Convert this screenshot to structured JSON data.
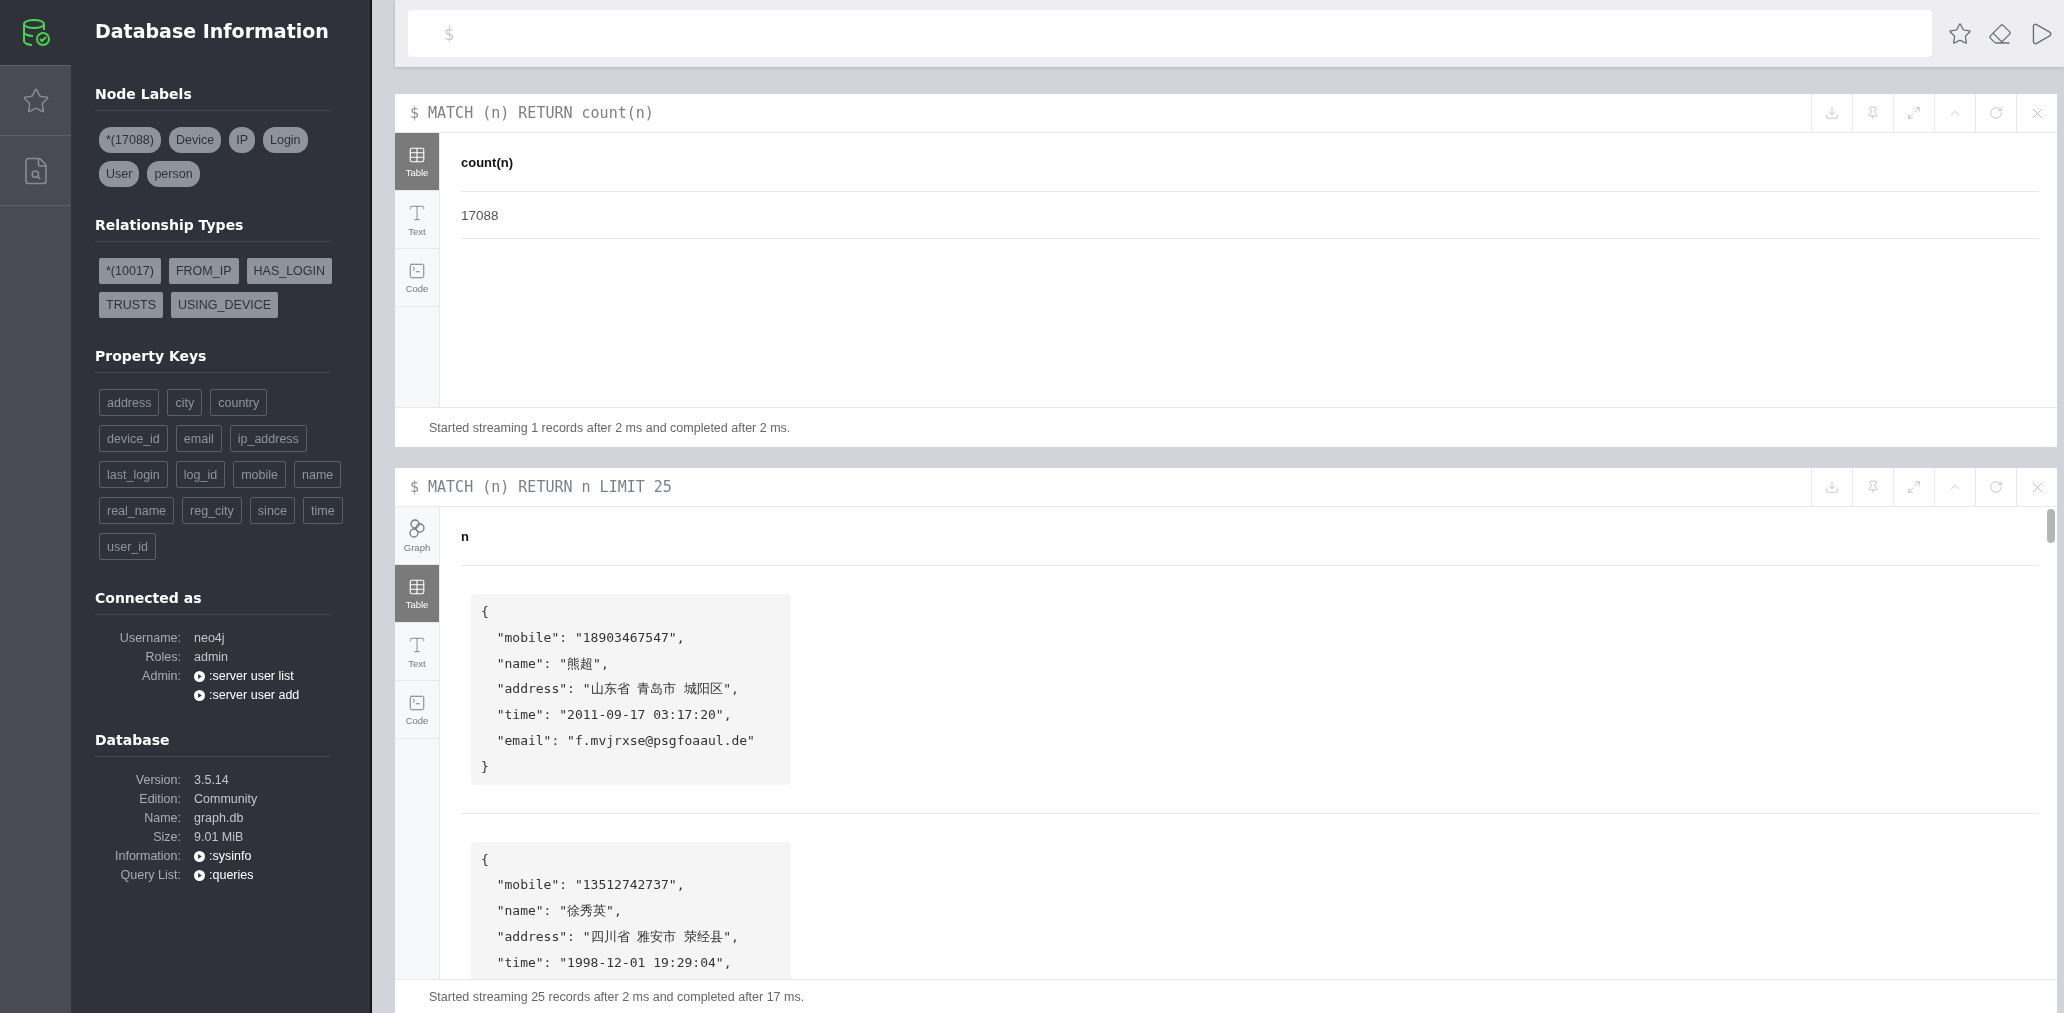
{
  "nav": [
    {
      "kind": "database",
      "selected": true
    },
    {
      "kind": "star",
      "selected": false
    },
    {
      "kind": "search",
      "selected": false
    }
  ],
  "sidebar": {
    "title": "Database Information",
    "sections": [
      {
        "kind": "labels",
        "title": "Node Labels",
        "items": [
          "*(17088)",
          "Device",
          "IP",
          "Login",
          "User",
          "person"
        ]
      },
      {
        "kind": "types",
        "title": "Relationship Types",
        "items": [
          "*(10017)",
          "FROM_IP",
          "HAS_LOGIN",
          "TRUSTS",
          "USING_DEVICE"
        ]
      },
      {
        "kind": "keys",
        "title": "Property Keys",
        "items": [
          "address",
          "city",
          "country",
          "device_id",
          "email",
          "ip_address",
          "last_login",
          "log_id",
          "mobile",
          "name",
          "real_name",
          "reg_city",
          "since",
          "time",
          "user_id"
        ]
      },
      {
        "kind": "info",
        "title": "Connected as",
        "rows": [
          {
            "label": "Username:",
            "value": "neo4j",
            "kind": "text"
          },
          {
            "label": "Roles:",
            "value": "admin",
            "kind": "text"
          },
          {
            "label": "Admin:",
            "value": ":server user list",
            "kind": "link"
          },
          {
            "value": ":server user add",
            "kind": "link"
          }
        ]
      },
      {
        "kind": "info",
        "title": "Database",
        "rows": [
          {
            "label": "Version:",
            "value": "3.5.14",
            "kind": "text"
          },
          {
            "label": "Edition:",
            "value": "Community",
            "kind": "text"
          },
          {
            "label": "Name:",
            "value": "graph.db",
            "kind": "text"
          },
          {
            "label": "Size:",
            "value": "9.01 MiB",
            "kind": "text"
          },
          {
            "label": "Information:",
            "value": ":sysinfo",
            "kind": "link"
          },
          {
            "label": "Query List:",
            "value": ":queries",
            "kind": "link"
          }
        ]
      }
    ]
  },
  "editor": {
    "prompt": "$"
  },
  "frames": [
    {
      "prompt": "$",
      "query": "MATCH (n) RETURN count(n)",
      "views": [
        {
          "kind": "table",
          "label": "Table",
          "selected": true
        },
        {
          "kind": "text",
          "label": "Text",
          "selected": false
        },
        {
          "kind": "code",
          "label": "Code",
          "selected": false
        }
      ],
      "column": "count(n)",
      "rows": [
        {
          "kind": "value",
          "value": "17088"
        }
      ],
      "status": "Started streaming 1 records after 2 ms and completed after 2 ms."
    },
    {
      "prompt": "$",
      "query": "MATCH (n) RETURN n LIMIT 25",
      "views": [
        {
          "kind": "graph",
          "label": "Graph",
          "selected": false
        },
        {
          "kind": "table",
          "label": "Table",
          "selected": true
        },
        {
          "kind": "text",
          "label": "Text",
          "selected": false
        },
        {
          "kind": "code",
          "label": "Code",
          "selected": false
        }
      ],
      "column": "n",
      "rows": [
        {
          "kind": "record",
          "lines": [
            "{",
            "  \"mobile\": \"18903467547\",",
            "  \"name\": \"熊超\",",
            "  \"address\": \"山东省 青岛市 城阳区\",",
            "  \"time\": \"2011-09-17 03:17:20\",",
            "  \"email\": \"f.mvjrxse@psgfoaaul.de\"",
            "}"
          ]
        },
        {
          "kind": "record",
          "lines": [
            "{",
            "  \"mobile\": \"13512742737\",",
            "  \"name\": \"徐秀英\",",
            "  \"address\": \"四川省 雅安市 荥经县\",",
            "  \"time\": \"1998-12-01 19:29:04\","
          ]
        }
      ],
      "status": "Started streaming 25 records after 2 ms and completed after 17 ms."
    }
  ]
}
